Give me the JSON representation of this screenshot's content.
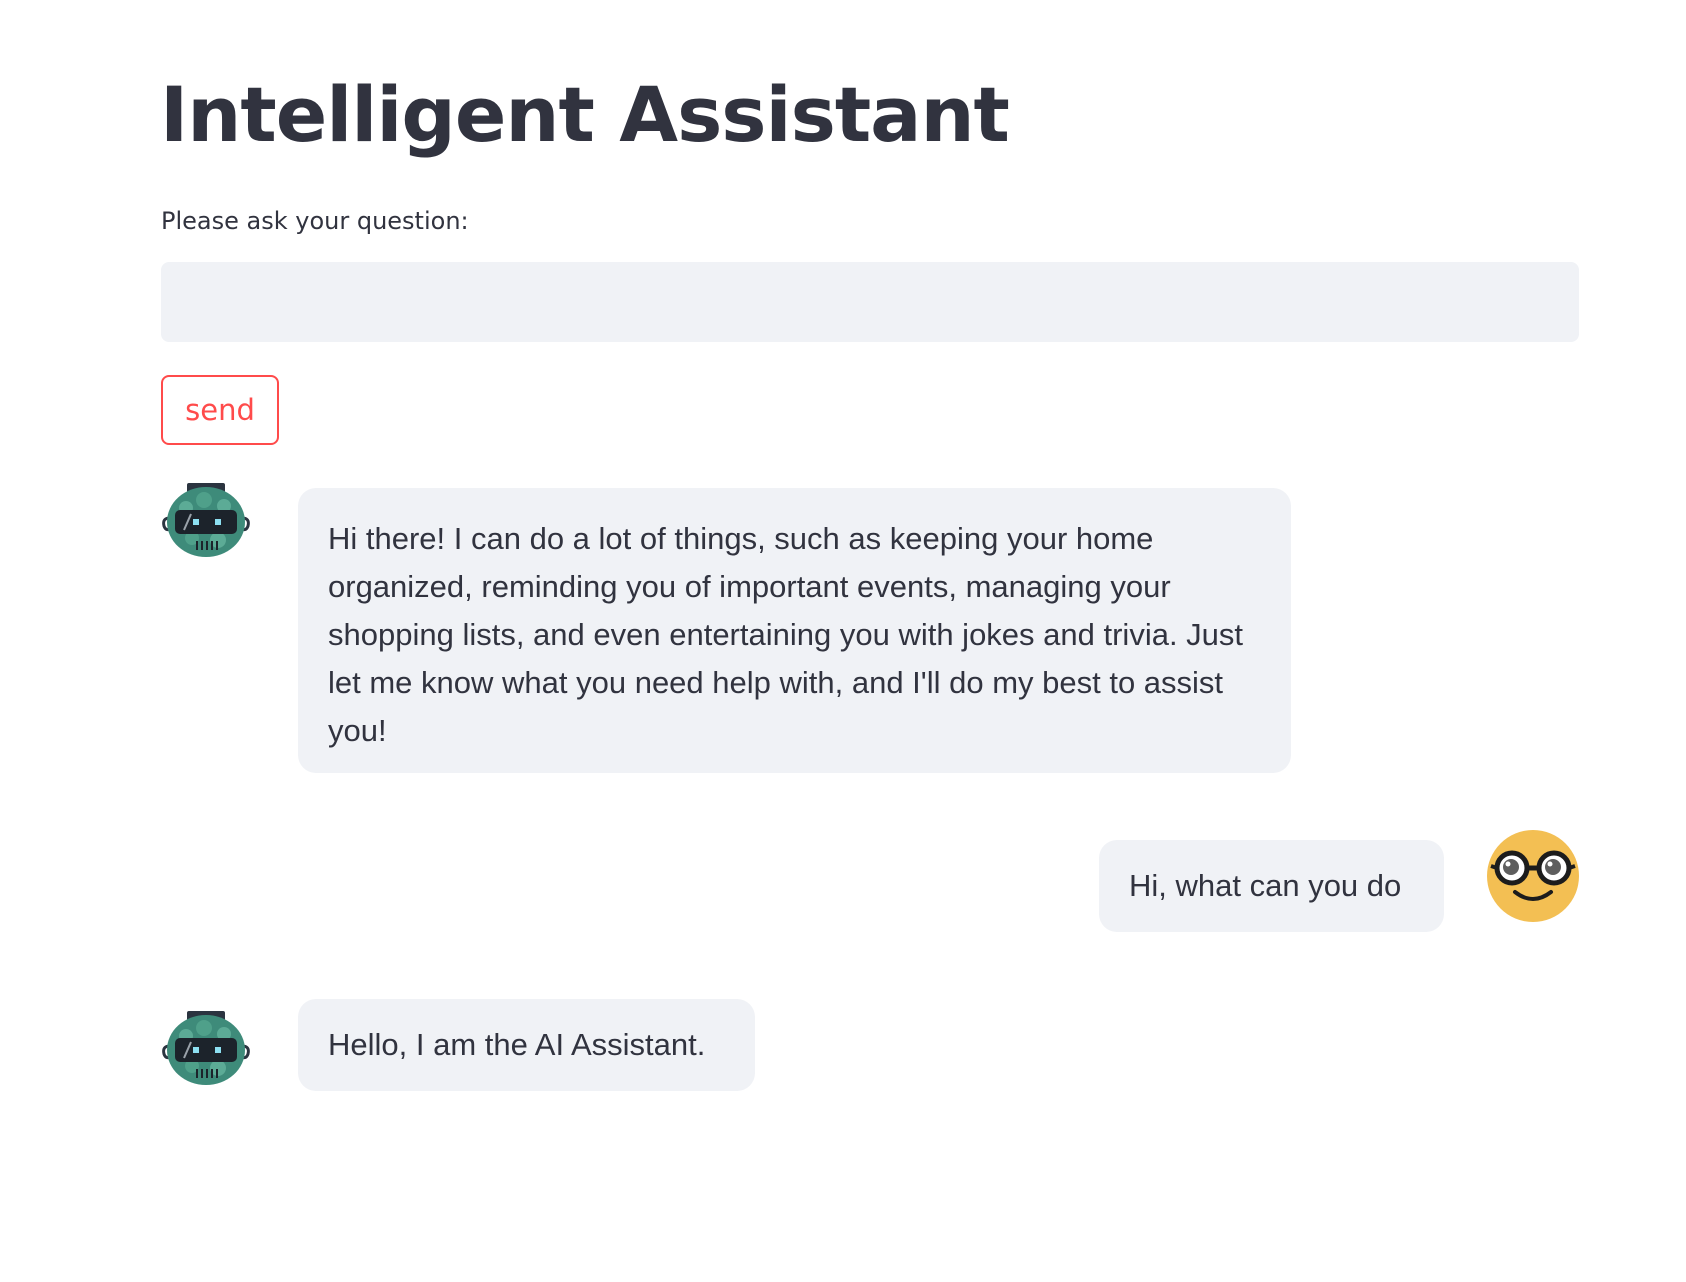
{
  "app": {
    "title": "Intelligent Assistant"
  },
  "input": {
    "label": "Please ask your question:",
    "value": ""
  },
  "send_button": {
    "label": "send",
    "color": "#ff4b4b"
  },
  "messages": [
    {
      "role": "assistant",
      "avatar_icon": "robot-icon",
      "text": "Hi there! I can do a lot of things, such as keeping your home organized, reminding you of important events, managing your shopping lists, and even entertaining you with jokes and trivia. Just let me know what you need help with, and I'll do my best to assist you!"
    },
    {
      "role": "user",
      "avatar_icon": "nerd-face-icon",
      "text": "Hi, what can you do"
    },
    {
      "role": "assistant",
      "avatar_icon": "robot-icon",
      "text": "Hello, I am the AI Assistant."
    }
  ],
  "colors": {
    "bubble_background": "#f0f2f6",
    "text": "#31333f",
    "user_avatar": "#f3bf53",
    "bot_avatar": "#3e8b7a"
  }
}
